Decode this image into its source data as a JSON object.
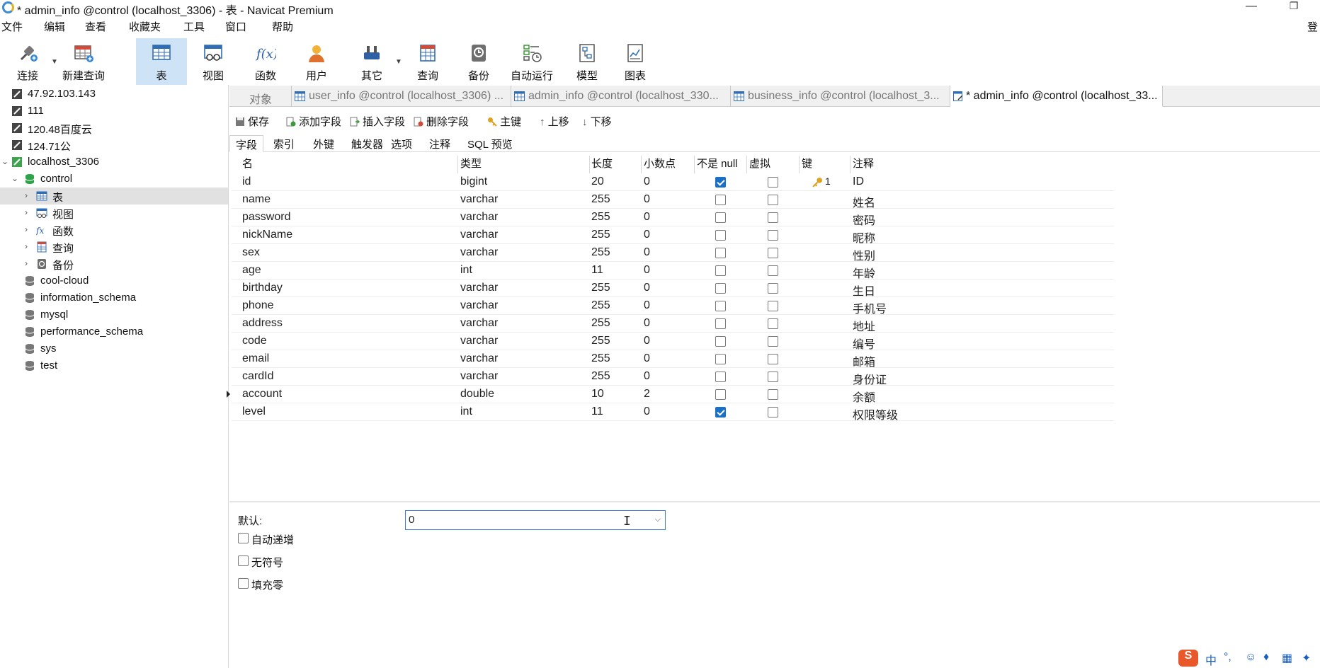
{
  "titlebar": {
    "title": "* admin_info @control (localhost_3306) - 表 - Navicat Premium",
    "minimize": "—",
    "restore": "❐"
  },
  "menubar": {
    "items": [
      "文件",
      "编辑",
      "查看",
      "收藏夹",
      "工具",
      "窗口",
      "帮助"
    ],
    "right_label": "登"
  },
  "toolbar": {
    "buttons": [
      {
        "label": "连接",
        "icon": "plug-icon"
      },
      {
        "label": "新建查询",
        "icon": "new-query-icon"
      },
      {
        "label": "表",
        "icon": "table-icon",
        "active": true
      },
      {
        "label": "视图",
        "icon": "view-icon"
      },
      {
        "label": "函数",
        "icon": "function-icon"
      },
      {
        "label": "用户",
        "icon": "user-icon"
      },
      {
        "label": "其它",
        "icon": "tools-icon"
      },
      {
        "label": "查询",
        "icon": "query-icon"
      },
      {
        "label": "备份",
        "icon": "backup-icon"
      },
      {
        "label": "自动运行",
        "icon": "schedule-icon"
      },
      {
        "label": "模型",
        "icon": "model-icon"
      },
      {
        "label": "图表",
        "icon": "chart-icon"
      }
    ]
  },
  "sidebar": {
    "items": [
      {
        "label": "47.92.103.143",
        "icon": "connection-icon"
      },
      {
        "label": "111",
        "icon": "connection-icon"
      },
      {
        "label": "120.48百度云",
        "icon": "connection-icon"
      },
      {
        "label": "124.71公",
        "icon": "connection-icon"
      },
      {
        "label": "localhost_3306",
        "icon": "connection-active-icon",
        "expanded": true
      },
      {
        "label": "control",
        "icon": "database-open-icon",
        "expanded": true
      },
      {
        "label": "表",
        "icon": "table-icon",
        "selected": true
      },
      {
        "label": "视图",
        "icon": "view-icon"
      },
      {
        "label": "函数",
        "icon": "function-icon"
      },
      {
        "label": "查询",
        "icon": "query-icon"
      },
      {
        "label": "备份",
        "icon": "backup-icon"
      },
      {
        "label": "cool-cloud",
        "icon": "database-icon"
      },
      {
        "label": "information_schema",
        "icon": "database-icon"
      },
      {
        "label": "mysql",
        "icon": "database-icon"
      },
      {
        "label": "performance_schema",
        "icon": "database-icon"
      },
      {
        "label": "sys",
        "icon": "database-icon"
      },
      {
        "label": "test",
        "icon": "database-icon"
      }
    ]
  },
  "tabs": {
    "objects_label": "对象",
    "items": [
      {
        "label": "user_info @control (localhost_3306) ..."
      },
      {
        "label": "admin_info @control (localhost_330..."
      },
      {
        "label": "business_info @control (localhost_3..."
      },
      {
        "label": "* admin_info @control (localhost_33...",
        "active": true
      }
    ]
  },
  "actions": {
    "save": "保存",
    "add_field": "添加字段",
    "insert_field": "插入字段",
    "delete_field": "删除字段",
    "primary_key": "主键",
    "move_up": "上移",
    "move_down": "下移"
  },
  "subtabs": {
    "items": [
      "字段",
      "索引",
      "外键",
      "触发器",
      "选项",
      "注释",
      "SQL 预览"
    ]
  },
  "grid": {
    "headers": [
      "名",
      "类型",
      "长度",
      "小数点",
      "不是 null",
      "虚拟",
      "键",
      "注释"
    ],
    "rows": [
      {
        "name": "id",
        "type": "bigint",
        "length": "20",
        "decimals": "0",
        "not_null": true,
        "virtual": false,
        "key": "1",
        "comment": "ID"
      },
      {
        "name": "name",
        "type": "varchar",
        "length": "255",
        "decimals": "0",
        "not_null": false,
        "virtual": false,
        "key": "",
        "comment": "姓名"
      },
      {
        "name": "password",
        "type": "varchar",
        "length": "255",
        "decimals": "0",
        "not_null": false,
        "virtual": false,
        "key": "",
        "comment": "密码"
      },
      {
        "name": "nickName",
        "type": "varchar",
        "length": "255",
        "decimals": "0",
        "not_null": false,
        "virtual": false,
        "key": "",
        "comment": "昵称"
      },
      {
        "name": "sex",
        "type": "varchar",
        "length": "255",
        "decimals": "0",
        "not_null": false,
        "virtual": false,
        "key": "",
        "comment": "性别"
      },
      {
        "name": "age",
        "type": "int",
        "length": "11",
        "decimals": "0",
        "not_null": false,
        "virtual": false,
        "key": "",
        "comment": "年龄"
      },
      {
        "name": "birthday",
        "type": "varchar",
        "length": "255",
        "decimals": "0",
        "not_null": false,
        "virtual": false,
        "key": "",
        "comment": "生日"
      },
      {
        "name": "phone",
        "type": "varchar",
        "length": "255",
        "decimals": "0",
        "not_null": false,
        "virtual": false,
        "key": "",
        "comment": "手机号"
      },
      {
        "name": "address",
        "type": "varchar",
        "length": "255",
        "decimals": "0",
        "not_null": false,
        "virtual": false,
        "key": "",
        "comment": "地址"
      },
      {
        "name": "code",
        "type": "varchar",
        "length": "255",
        "decimals": "0",
        "not_null": false,
        "virtual": false,
        "key": "",
        "comment": "编号"
      },
      {
        "name": "email",
        "type": "varchar",
        "length": "255",
        "decimals": "0",
        "not_null": false,
        "virtual": false,
        "key": "",
        "comment": "邮箱"
      },
      {
        "name": "cardId",
        "type": "varchar",
        "length": "255",
        "decimals": "0",
        "not_null": false,
        "virtual": false,
        "key": "",
        "comment": "身份证"
      },
      {
        "name": "account",
        "type": "double",
        "length": "10",
        "decimals": "2",
        "not_null": false,
        "virtual": false,
        "key": "",
        "comment": "余额",
        "current": true
      },
      {
        "name": "level",
        "type": "int",
        "length": "11",
        "decimals": "0",
        "not_null": true,
        "virtual": false,
        "key": "",
        "comment": "权限等级"
      }
    ]
  },
  "properties": {
    "default_label": "默认:",
    "default_value": "0",
    "auto_increment": "自动递增",
    "unsigned": "无符号",
    "zerofill": "填充零"
  },
  "tray": {
    "ime_label": "中",
    "punct": "°,"
  },
  "colors": {
    "accent": "#1a6fc7",
    "active_toolbar": "#cfe3f6",
    "selected_tree": "#e1e1e1"
  }
}
